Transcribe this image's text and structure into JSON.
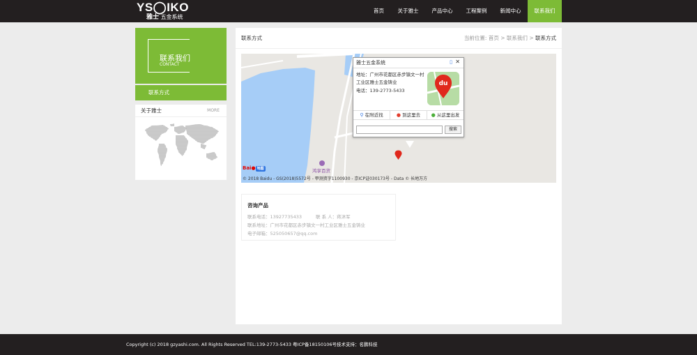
{
  "header": {
    "logo_text": "YS◯IKO",
    "logo_sub_bold": "雅士",
    "logo_sub": "五金系统"
  },
  "nav": {
    "items": [
      {
        "label": "首页"
      },
      {
        "label": "关于雅士"
      },
      {
        "label": "产品中心"
      },
      {
        "label": "工程案例"
      },
      {
        "label": "新闻中心"
      },
      {
        "label": "联系我们"
      }
    ],
    "active_color": "#7dbb36"
  },
  "sidebar": {
    "banner_title": "联系我们",
    "banner_title_en": "CONTACT",
    "menu_item": "联系方式",
    "about_title": "关于雅士",
    "about_more": "MORE"
  },
  "main": {
    "title": "联系方式",
    "breadcrumb": {
      "prefix": "当前位置:",
      "home": "首页",
      "sep1": ">",
      "section": "联系我们",
      "sep2": ">",
      "current": "联系方式"
    }
  },
  "map": {
    "copyright": "© 2018 Baidu - GS(2018)5572号 - 甲测资字1100930 - 京ICP证030173号 - Data © 长地万方",
    "poi_label": "鸿享百货",
    "baidu_text": "Bai",
    "baidu_badge": "地图",
    "popup": {
      "title": "雅士五金系统",
      "address": "地址：广州市花都区赤步镇文一村工业区雅士五金铸业",
      "phone": "电话：139-2773-5433",
      "tabs": [
        "在附近找",
        "到这里去",
        "从这里出发"
      ],
      "search_button": "搜索",
      "icon_text": "du"
    }
  },
  "contact": {
    "title": "咨询产品",
    "phone_label": "联系电话：13927735433",
    "person_label": "联 系 人：蒋沐军",
    "address_label": "联系地址：广州市花都区赤步镇文一村工业区雅士五金铸业",
    "email_label": "电子邮箱：525050657@qq.com"
  },
  "footer": {
    "text": "Copyright (c) 2018 gzyashi.com. All Rights Reserved TEL:139-2773-5433     粤ICP备18150106号技术支持：名鹏科技"
  }
}
